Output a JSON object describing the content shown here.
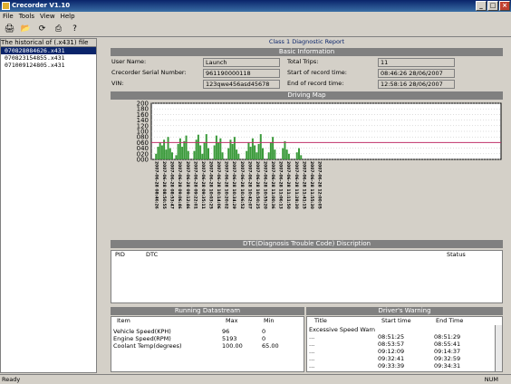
{
  "window": {
    "title": "Crecorder V1.10",
    "buttons": [
      "_",
      "□",
      "×"
    ]
  },
  "menu": [
    "File",
    "Tools",
    "View",
    "Help"
  ],
  "toolbar": [
    "print-icon",
    "open-folder-icon",
    "refresh-icon",
    "printer-icon",
    "help-icon"
  ],
  "files": {
    "header": "The historical of (.x431) file",
    "items": [
      "070828084626.x431",
      "070823154855.x431",
      "071009124805.x431"
    ]
  },
  "report": {
    "title": "Class 1 Diagnostic Report"
  },
  "basic": {
    "header": "Basic Information",
    "user_label": "User Name:",
    "user": "Launch",
    "serial_label": "Crecorder Serial Number:",
    "serial": "961190000118",
    "vin_label": "VIN:",
    "vin": "123qwe456asd45678",
    "trips_label": "Total Trips:",
    "trips": "11",
    "start_label": "Start of record time:",
    "start": "08:46:26 28/06/2007",
    "end_label": "End of record time:",
    "end": "12:58:16 28/06/2007"
  },
  "driving": {
    "header": "Driving Map"
  },
  "chart_data": {
    "type": "area",
    "yticks": [
      "200",
      "180",
      "160",
      "140",
      "120",
      "100",
      "080",
      "060",
      "040",
      "020",
      "000"
    ],
    "ylim": [
      0,
      200
    ],
    "threshold": 60,
    "colors": {
      "fill": "#3a9a3a",
      "threshold": "#c0306a"
    },
    "xlabels": [
      "2007-06-28 08:46:26",
      "2007-06-28 08:50:55",
      "2007-06-28 08:53:47",
      "2007-06-28 09:06:46",
      "2007-06-28 09:12:46",
      "2007-06-28 09:22:01",
      "2007-06-28 09:35:11",
      "2007-06-28 10:03:25",
      "2007-06-28 10:14:06",
      "2007-06-28 10:20:02",
      "2007-06-28 10:34:29",
      "2007-06-28 10:36:52",
      "2007-06-28 10:42:07",
      "2007-06-28 10:50:25",
      "2007-06-28 10:55:20",
      "2007-06-28 11:00:36",
      "2007-06-28 11:06:13",
      "2007-06-28 11:11:50",
      "2007-06-28 11:28:30",
      "2007-06-28 11:41:15",
      "2007-06-28 11:55:30",
      "2007-06-28 12:00:05"
    ],
    "values": [
      0,
      20,
      45,
      60,
      50,
      70,
      35,
      80,
      40,
      25,
      0,
      15,
      55,
      75,
      45,
      65,
      85,
      30,
      0,
      0,
      30,
      70,
      88,
      50,
      20,
      60,
      90,
      40,
      0,
      0,
      50,
      85,
      60,
      75,
      25,
      0,
      0,
      40,
      70,
      55,
      80,
      35,
      20,
      0,
      0,
      0,
      30,
      60,
      45,
      75,
      50,
      25,
      55,
      90,
      40,
      0,
      0,
      25,
      60,
      80,
      35,
      0,
      0,
      0,
      40,
      65,
      35,
      20,
      0,
      0,
      0,
      25,
      40,
      15,
      0,
      0,
      0,
      0,
      0,
      0,
      0,
      0
    ]
  },
  "dtc": {
    "header": "DTC(Diagnosis Trouble Code) Discription",
    "cols": [
      "PID",
      "DTC",
      "Status"
    ]
  },
  "datastream": {
    "header": "Running Datastream",
    "cols": [
      "Item",
      "Max",
      "Min"
    ],
    "rows": [
      [
        "Vehicle Speed(KPH)",
        "96",
        "0"
      ],
      [
        "Engine Speed(RPM)",
        "5193",
        "0"
      ],
      [
        "Coolant Temp(degrees)",
        "100.00",
        "65.00"
      ]
    ]
  },
  "warning": {
    "header": "Driver's Warning",
    "cols": [
      "Title",
      "Start time",
      "End Time"
    ],
    "rows": [
      [
        "Excessive Speed Warn",
        "",
        ""
      ],
      [
        "...",
        "08:51:25",
        "08:51:29"
      ],
      [
        "...",
        "08:53:57",
        "08:55:41"
      ],
      [
        "...",
        "09:12:09",
        "09:14:37"
      ],
      [
        "...",
        "09:32:41",
        "09:32:59"
      ],
      [
        "...",
        "09:33:39",
        "09:34:31"
      ]
    ]
  },
  "status": {
    "left": "Ready",
    "right": "NUM"
  }
}
